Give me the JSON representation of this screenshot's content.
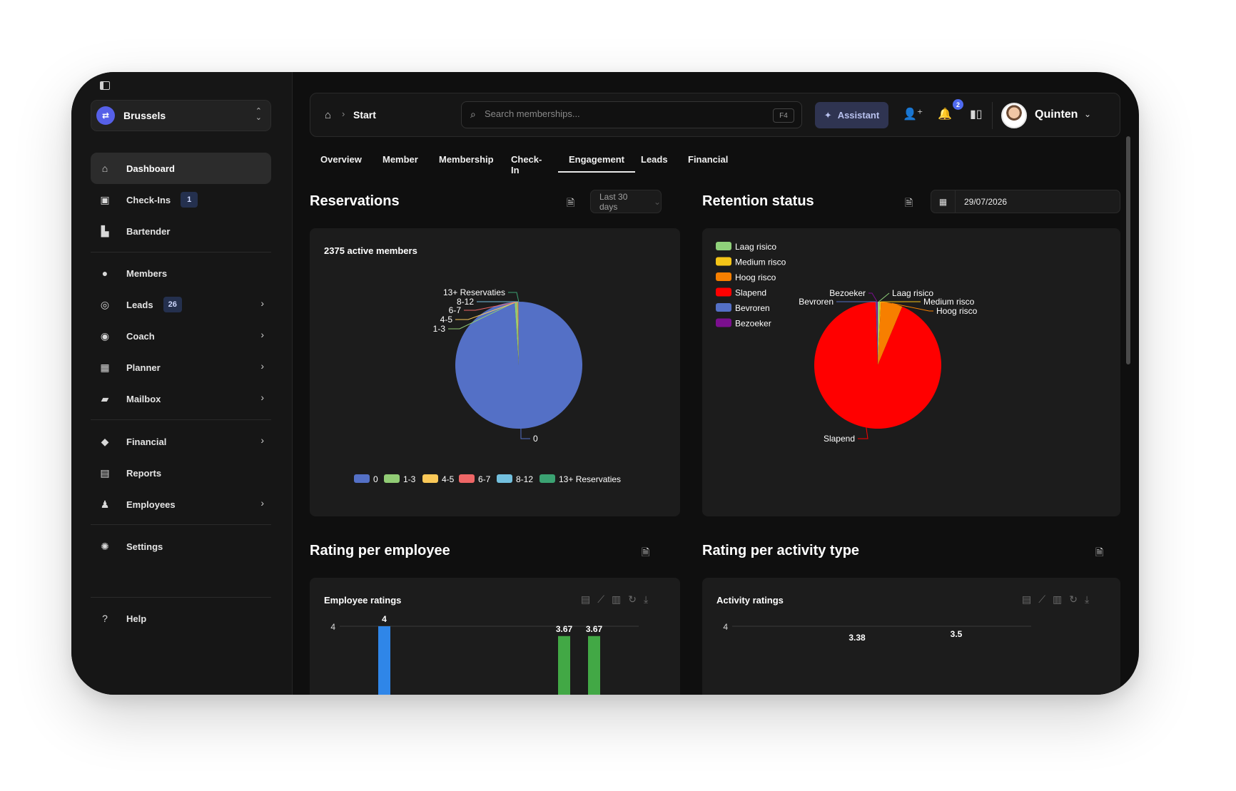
{
  "sidebar": {
    "location": "Brussels",
    "items": [
      {
        "label": "Dashboard",
        "icon": "home-icon"
      },
      {
        "label": "Check-Ins",
        "badge": "1",
        "icon": "checkin-icon"
      },
      {
        "label": "Bartender",
        "icon": "bartender-icon"
      },
      {
        "label": "Members",
        "icon": "members-icon"
      },
      {
        "label": "Leads",
        "badge": "26",
        "icon": "leads-icon"
      },
      {
        "label": "Coach",
        "icon": "coach-icon"
      },
      {
        "label": "Planner",
        "icon": "planner-icon"
      },
      {
        "label": "Mailbox",
        "icon": "mailbox-icon"
      },
      {
        "label": "Financial",
        "icon": "financial-icon"
      },
      {
        "label": "Reports",
        "icon": "reports-icon"
      },
      {
        "label": "Employees",
        "icon": "employees-icon"
      },
      {
        "label": "Settings",
        "icon": "settings-icon"
      },
      {
        "label": "Help",
        "icon": "help-icon"
      }
    ]
  },
  "topbar": {
    "breadcrumb": "Start",
    "search_placeholder": "Search memberships...",
    "search_shortcut": "F4",
    "assistant_label": "Assistant",
    "notification_count": "2",
    "user_name": "Quinten"
  },
  "tabs": [
    "Overview",
    "Member",
    "Membership",
    "Check-In",
    "Engagement",
    "Leads",
    "Financial"
  ],
  "active_tab": "Engagement",
  "sections": {
    "reservations": {
      "title": "Reservations",
      "filter": "Last 30 days"
    },
    "retention": {
      "title": "Retention status",
      "date": "29/07/2026"
    },
    "rating_employee": {
      "title": "Rating per employee"
    },
    "rating_activity": {
      "title": "Rating per activity type"
    }
  },
  "colors": {
    "accent": "#5660e8",
    "badge_bg": "#24304e",
    "assistant_bg": "#2f3451",
    "card_bg": "#1c1c1c"
  },
  "chart_data": [
    {
      "type": "pie",
      "title": "2375 active members",
      "labels": [
        "0",
        "1-3",
        "4-5",
        "6-7",
        "8-12",
        "13+ Reservaties"
      ],
      "values": [
        2350,
        15,
        4,
        3,
        2,
        1
      ],
      "colors": [
        "#5470c6",
        "#91cc75",
        "#fac858",
        "#ee6666",
        "#73c0de",
        "#3ba272"
      ],
      "legend_position": "bottom"
    },
    {
      "type": "pie",
      "labels": [
        "Laag risico",
        "Medium risco",
        "Hoog risco",
        "Slapend",
        "Bevroren",
        "Bezoeker"
      ],
      "values": [
        5,
        3,
        55,
        932,
        2,
        3
      ],
      "colors": [
        "#8fd17a",
        "#f5c518",
        "#f77f00",
        "#ff0000",
        "#5470c6",
        "#7b0f8f"
      ],
      "legend_position": "top-left"
    },
    {
      "type": "bar",
      "title": "Employee ratings",
      "ylim_top": 4,
      "visible_data_labels": [
        4,
        3.67,
        3.67
      ],
      "colors": [
        "#2f86e8",
        "#42a845",
        "#42a845"
      ]
    },
    {
      "type": "bar",
      "title": "Activity ratings",
      "ylim_top": 4,
      "visible_data_labels": [
        3.38,
        3.5
      ]
    }
  ]
}
